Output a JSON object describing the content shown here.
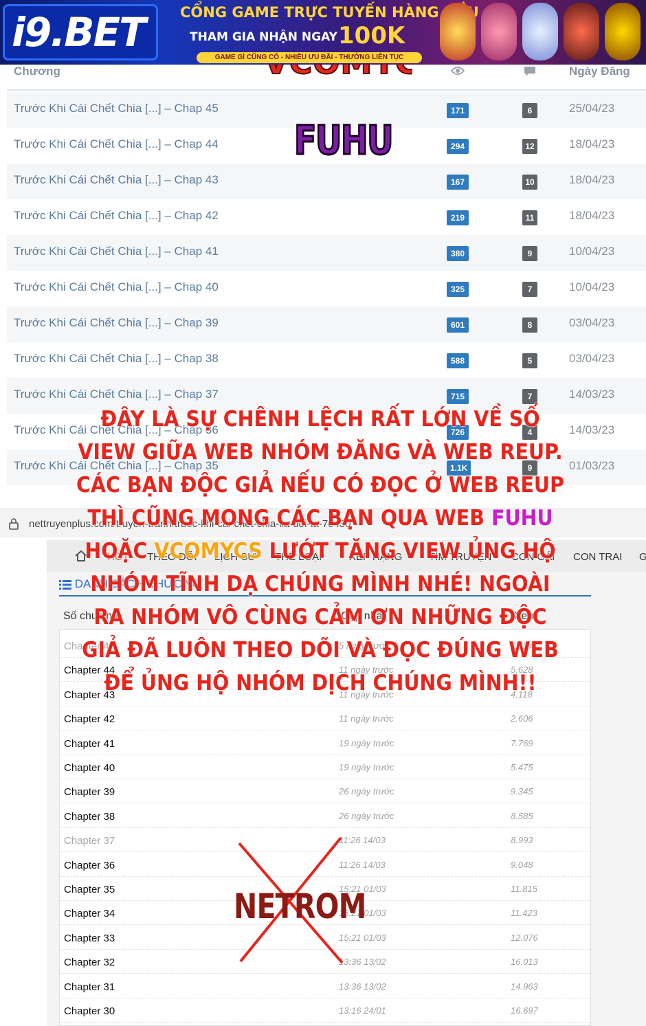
{
  "banner": {
    "logo": "i9.BET",
    "headline": "CỔNG GAME TRỰC TUYẾN HÀNG ĐẦU",
    "join_text": "THAM GIA NHẬN NGAY",
    "bonus": "100K",
    "tagline": "GAME GÌ CŨNG CÓ - NHIỀU ƯU ĐÃI - THƯỞNG LIÊN TỤC"
  },
  "top_table": {
    "col_chapter": "Chương",
    "col_date": "Ngày Đăng",
    "rows": [
      {
        "title": "Trước Khi Cái Chết Chia [...] – Chap 45",
        "views": "171",
        "comments": "6",
        "date": "25/04/23"
      },
      {
        "title": "Trước Khi Cái Chết Chia [...] – Chap 44",
        "views": "294",
        "comments": "12",
        "date": "18/04/23"
      },
      {
        "title": "Trước Khi Cái Chết Chia [...] – Chap 43",
        "views": "167",
        "comments": "10",
        "date": "18/04/23"
      },
      {
        "title": "Trước Khi Cái Chết Chia [...] – Chap 42",
        "views": "219",
        "comments": "11",
        "date": "18/04/23"
      },
      {
        "title": "Trước Khi Cái Chết Chia [...] – Chap 41",
        "views": "380",
        "comments": "9",
        "date": "10/04/23"
      },
      {
        "title": "Trước Khi Cái Chết Chia [...] – Chap 40",
        "views": "325",
        "comments": "7",
        "date": "10/04/23"
      },
      {
        "title": "Trước Khi Cái Chết Chia [...] – Chap 39",
        "views": "601",
        "comments": "8",
        "date": "03/04/23"
      },
      {
        "title": "Trước Khi Cái Chết Chia [...] – Chap 38",
        "views": "588",
        "comments": "5",
        "date": "03/04/23"
      },
      {
        "title": "Trước Khi Cái Chết Chia [...] – Chap 37",
        "views": "715",
        "comments": "7",
        "date": "14/03/23"
      },
      {
        "title": "Trước Khi Cái Chết Chia [...] – Chap 36",
        "views": "726",
        "comments": "4",
        "date": "14/03/23"
      },
      {
        "title": "Trước Khi Cái Chết Chia [...] – Chap 35",
        "views": "1.1K",
        "comments": "9",
        "date": "01/03/23"
      }
    ]
  },
  "watermarks": {
    "vcomycs": "VCOMYCS",
    "fuhu": "FUHU",
    "netrom": "NETROM"
  },
  "notice": {
    "part1": "ĐÂY LÀ SỰ CHÊNH LỆCH RẤT LỚN VỀ SỐ VIEW GIỮA WEB NHÓM ĐĂNG VÀ WEB REUP. CÁC BẠN ĐỘC GIẢ NẾU CÓ ĐỌC Ở WEB REUP THÌ CŨNG MONG CÁC BẠN QUA WEB ",
    "fuhu": "FUHU",
    "part2": " HOẶC ",
    "vcomycs": "VCOMYCS",
    "part3": " LƯỚT TĂNG VIEW ỦNG HỘ NHÓM TĨNH DẠ CHÚNG MÌNH NHÉ! NGOÀI RA NHÓM VÔ CÙNG CẢM ƠN NHỮNG ĐỘC GIẢ ĐÃ LUÔN THEO DÕI VÀ ĐỌC ĐÚNG WEB ĐỂ ỦNG HỘ NHÓM DỊCH CHÚNG MÌNH!!"
  },
  "browser": {
    "url": "nettruyenplus.com/truyen-tranh/truoc-khi-cai-chet-chia-lia-doi-ta-70430"
  },
  "nav": {
    "items": [
      "HOT",
      "THEO DÕI",
      "LỊCH SỬ",
      "THỂ LOẠI",
      "XẾP HẠNG",
      "TÌM TRUYỆN",
      "CON GÁI",
      "CON TRAI",
      "G"
    ]
  },
  "chapter_list": {
    "heading": "DANH SÁCH CHƯƠNG",
    "col_chapter": "Số chương",
    "col_updated": "Cập nhật",
    "col_views": "Xem",
    "rows": [
      {
        "name": "Chapter 45",
        "updated": "5 ngày trước",
        "views": "3.557",
        "visited": true
      },
      {
        "name": "Chapter 44",
        "updated": "11 ngày trước",
        "views": "5.628",
        "visited": false
      },
      {
        "name": "Chapter 43",
        "updated": "11 ngày trước",
        "views": "4.118",
        "visited": false
      },
      {
        "name": "Chapter 42",
        "updated": "11 ngày trước",
        "views": "2.606",
        "visited": false
      },
      {
        "name": "Chapter 41",
        "updated": "19 ngày trước",
        "views": "7.769",
        "visited": false
      },
      {
        "name": "Chapter 40",
        "updated": "19 ngày trước",
        "views": "5.475",
        "visited": false
      },
      {
        "name": "Chapter 39",
        "updated": "26 ngày trước",
        "views": "9.345",
        "visited": false
      },
      {
        "name": "Chapter 38",
        "updated": "26 ngày trước",
        "views": "8.585",
        "visited": false
      },
      {
        "name": "Chapter 37",
        "updated": "11:26 14/03",
        "views": "8.993",
        "visited": true
      },
      {
        "name": "Chapter 36",
        "updated": "11:26 14/03",
        "views": "9.048",
        "visited": false
      },
      {
        "name": "Chapter 35",
        "updated": "15:21 01/03",
        "views": "11.815",
        "visited": false
      },
      {
        "name": "Chapter 34",
        "updated": "15:21 01/03",
        "views": "11.423",
        "visited": false
      },
      {
        "name": "Chapter 33",
        "updated": "15:21 01/03",
        "views": "12.076",
        "visited": false
      },
      {
        "name": "Chapter 32",
        "updated": "13:36 13/02",
        "views": "16.013",
        "visited": false
      },
      {
        "name": "Chapter 31",
        "updated": "13:36 13/02",
        "views": "14.963",
        "visited": false
      },
      {
        "name": "Chapter 30",
        "updated": "13:16 24/01",
        "views": "16.697",
        "visited": false
      }
    ]
  },
  "icons": {
    "views": "eye-icon",
    "comments": "comment-icon",
    "lock": "lock-icon",
    "list": "list-icon",
    "home": "home-icon"
  },
  "colors": {
    "view_badge": "#2f7bbf",
    "comment_badge": "#5f6266",
    "notice_text": "#e8251c",
    "fuhu": "#c91fc9",
    "vcomycs": "#f5a614",
    "link": "#5b7c9e"
  }
}
